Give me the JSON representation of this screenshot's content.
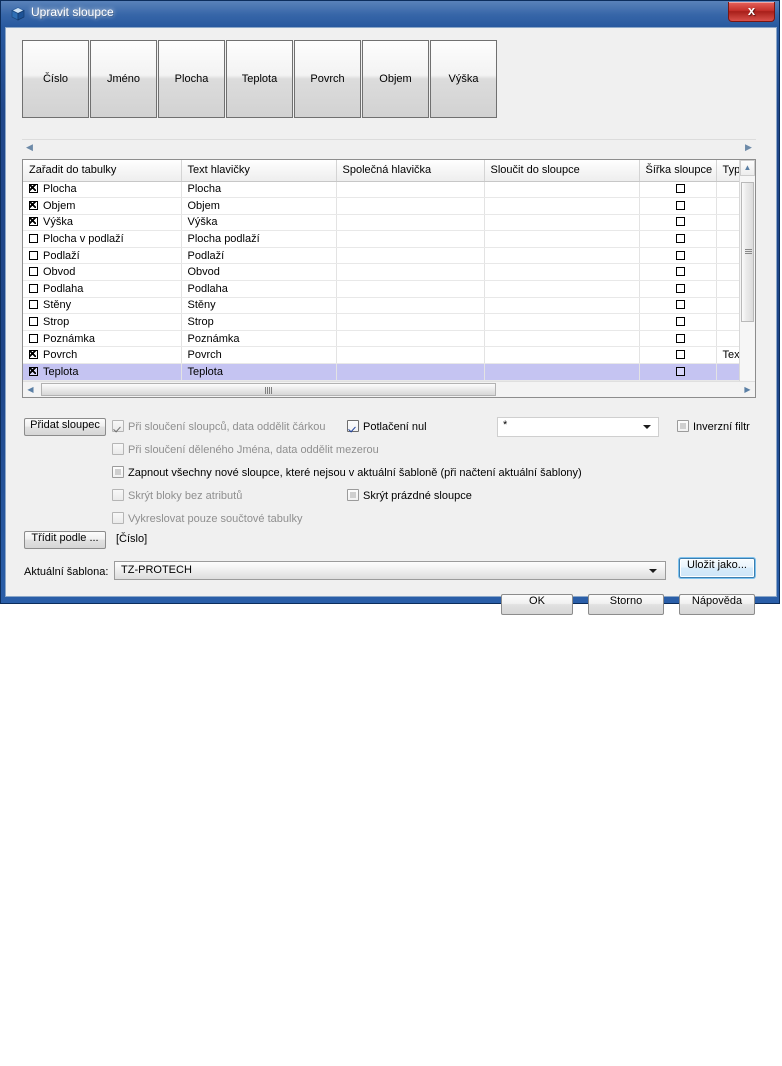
{
  "window": {
    "title": "Upravit sloupce",
    "icon": "app-cube-icon",
    "close_label": "x",
    "accent_title_bg": "#1e4588",
    "close_red": "#c4302b"
  },
  "column_buttons": [
    {
      "label": "Číslo"
    },
    {
      "label": "Jméno"
    },
    {
      "label": "Plocha"
    },
    {
      "label": "Teplota"
    },
    {
      "label": "Povrch"
    },
    {
      "label": "Objem"
    },
    {
      "label": "Výška"
    }
  ],
  "grid": {
    "headers": [
      "Zařadit do tabulky",
      "Text hlavičky",
      "Společná hlavička",
      "Sloučit do sloupce",
      "Šířka sloupce",
      "Typ"
    ],
    "rows": [
      {
        "include": true,
        "name": "Plocha",
        "header_text": "Plocha",
        "common_header": "",
        "merge_into": "",
        "width_checked": false,
        "type": "",
        "selected": false
      },
      {
        "include": true,
        "name": "Objem",
        "header_text": "Objem",
        "common_header": "",
        "merge_into": "",
        "width_checked": false,
        "type": "",
        "selected": false
      },
      {
        "include": true,
        "name": "Výška",
        "header_text": "Výška",
        "common_header": "",
        "merge_into": "",
        "width_checked": false,
        "type": "",
        "selected": false
      },
      {
        "include": false,
        "name": "Plocha v podlaží",
        "header_text": "Plocha podlaží",
        "common_header": "",
        "merge_into": "",
        "width_checked": false,
        "type": "",
        "selected": false
      },
      {
        "include": false,
        "name": "Podlaží",
        "header_text": "Podlaží",
        "common_header": "",
        "merge_into": "",
        "width_checked": false,
        "type": "",
        "selected": false
      },
      {
        "include": false,
        "name": "Obvod",
        "header_text": "Obvod",
        "common_header": "",
        "merge_into": "",
        "width_checked": false,
        "type": "",
        "selected": false
      },
      {
        "include": false,
        "name": "Podlaha",
        "header_text": "Podlaha",
        "common_header": "",
        "merge_into": "",
        "width_checked": false,
        "type": "",
        "selected": false
      },
      {
        "include": false,
        "name": "Stěny",
        "header_text": "Stěny",
        "common_header": "",
        "merge_into": "",
        "width_checked": false,
        "type": "",
        "selected": false
      },
      {
        "include": false,
        "name": "Strop",
        "header_text": "Strop",
        "common_header": "",
        "merge_into": "",
        "width_checked": false,
        "type": "",
        "selected": false
      },
      {
        "include": false,
        "name": "Poznámka",
        "header_text": "Poznámka",
        "common_header": "",
        "merge_into": "",
        "width_checked": false,
        "type": "",
        "selected": false
      },
      {
        "include": true,
        "name": "Povrch",
        "header_text": "Povrch",
        "common_header": "",
        "merge_into": "",
        "width_checked": false,
        "type": "Text",
        "selected": false
      },
      {
        "include": true,
        "name": "Teplota",
        "header_text": "Teplota",
        "common_header": "",
        "merge_into": "",
        "width_checked": false,
        "type": "",
        "selected": true
      }
    ]
  },
  "options": {
    "add_column_label": "Přidat sloupec",
    "sort_by_label": "Třídit podle ...",
    "sort_by_value": "[Číslo]",
    "checkboxes": [
      {
        "label": "Při sloučení sloupců, data oddělit čárkou",
        "checked": true,
        "enabled": false,
        "state": "checked"
      },
      {
        "label": "Při sloučení děleného Jména, data oddělit mezerou",
        "checked": false,
        "enabled": false,
        "state": "unchecked"
      },
      {
        "label": "Zapnout všechny nové sloupce, které nejsou v aktuální šabloně (při načtení aktuální šablony)",
        "checked": false,
        "enabled": true,
        "state": "indeterminate"
      },
      {
        "label": "Skrýt bloky bez atributů",
        "checked": false,
        "enabled": false,
        "state": "unchecked"
      },
      {
        "label": "Vykreslovat pouze součtové tabulky",
        "checked": false,
        "enabled": false,
        "state": "unchecked"
      },
      {
        "label": "Potlačení nul",
        "checked": true,
        "enabled": true,
        "state": "checked"
      },
      {
        "label": "Skrýt prázdné sloupce",
        "checked": false,
        "enabled": true,
        "state": "indeterminate"
      },
      {
        "label": "Inverzní filtr",
        "checked": false,
        "enabled": true,
        "state": "indeterminate"
      }
    ],
    "filter_value": "*"
  },
  "template": {
    "label": "Aktuální šablona:",
    "value": "TZ-PROTECH",
    "save_as_label": "Uložit jako..."
  },
  "footer": {
    "ok_label": "OK",
    "cancel_label": "Storno",
    "help_label": "Nápověda"
  },
  "scroll": {
    "left_arrow": "◀",
    "right_arrow": "▶",
    "up_arrow": "▲",
    "down_arrow": "▼"
  }
}
